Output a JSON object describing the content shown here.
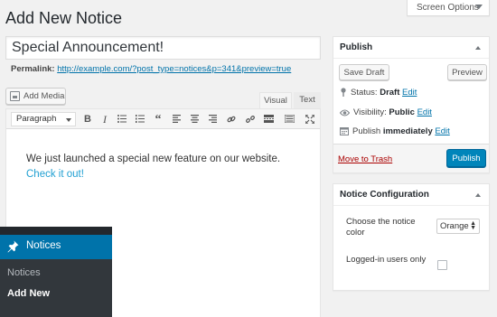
{
  "header": {
    "title": "Add New Notice",
    "screen_options": "Screen Options"
  },
  "post": {
    "title_value": "Special Announcement!",
    "permalink_label": "Permalink:",
    "permalink_url": "http://example.com/?post_type=notices&p=341&preview=true"
  },
  "editor": {
    "add_media": "Add Media",
    "tab_visual": "Visual",
    "tab_text": "Text",
    "format": "Paragraph",
    "content_text": "We just launched a special new feature on our website. ",
    "content_link": "Check it out!"
  },
  "admin_menu": {
    "main": "Notices",
    "sub_items": [
      "Notices",
      "Add New"
    ]
  },
  "publish": {
    "title": "Publish",
    "save_draft": "Save Draft",
    "preview": "Preview",
    "status_label": "Status:",
    "status_value": "Draft",
    "visibility_label": "Visibility:",
    "visibility_value": "Public",
    "publish_label": "Publish",
    "publish_value": "immediately",
    "edit": "Edit",
    "move_to_trash": "Move to Trash",
    "publish_button": "Publish"
  },
  "config": {
    "title": "Notice Configuration",
    "color_label": "Choose the notice color",
    "color_value": "Orange",
    "loggedin_label": "Logged-in users only",
    "loggedin_checked": false
  },
  "colors": {
    "primary": "#0085ba",
    "link": "#0073aa",
    "menu_bg": "#23282d",
    "menu_active": "#0073aa",
    "trash": "#a00"
  }
}
